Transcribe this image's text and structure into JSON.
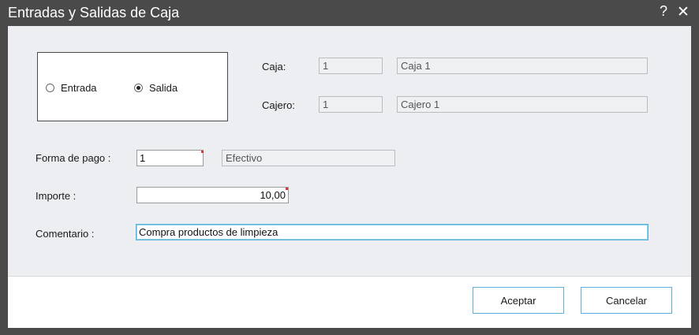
{
  "window": {
    "title": "Entradas y Salidas de Caja",
    "help_glyph": "?",
    "close_glyph": "✕"
  },
  "movement_type": {
    "options": [
      {
        "label": "Entrada",
        "checked": false
      },
      {
        "label": "Salida",
        "checked": true
      }
    ]
  },
  "caja": {
    "label": "Caja:",
    "code": "1",
    "name": "Caja 1"
  },
  "cajero": {
    "label": "Cajero:",
    "code": "1",
    "name": "Cajero 1"
  },
  "forma_pago": {
    "label": "Forma de pago :",
    "code": "1",
    "name": "Efectivo"
  },
  "importe": {
    "label": "Importe :",
    "value": "10,00"
  },
  "comentario": {
    "label": "Comentario :",
    "value": "Compra productos de limpieza"
  },
  "buttons": {
    "accept": "Aceptar",
    "cancel": "Cancelar"
  },
  "colors": {
    "titlebar": "#4a4a4a",
    "accent": "#5ab0d8",
    "required_marker": "#e03030"
  }
}
